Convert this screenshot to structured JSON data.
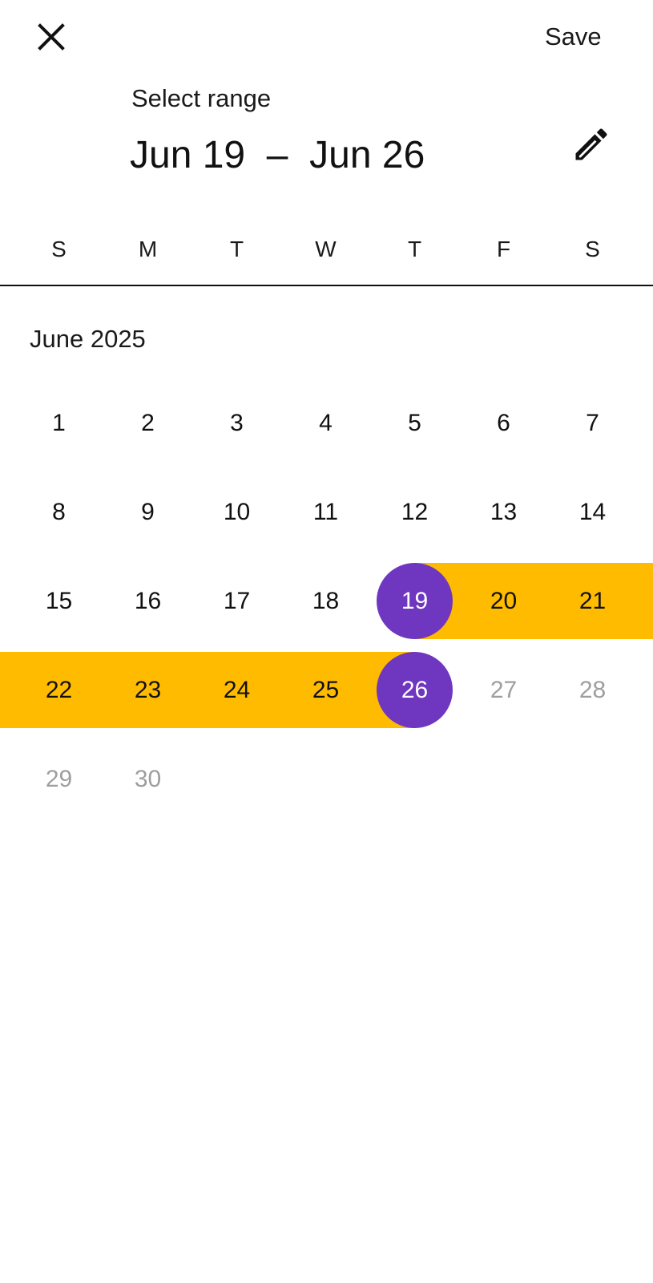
{
  "header": {
    "close_icon": "close-icon",
    "save_label": "Save",
    "range_label": "Select range",
    "range_value": "Jun 19  –  Jun 26",
    "edit_icon": "pencil-icon"
  },
  "weekdays": [
    "S",
    "M",
    "T",
    "W",
    "T",
    "F",
    "S"
  ],
  "month": {
    "title": "June 2025",
    "first_weekday_index": 0,
    "days": [
      {
        "n": "1",
        "state": "normal"
      },
      {
        "n": "2",
        "state": "normal"
      },
      {
        "n": "3",
        "state": "normal"
      },
      {
        "n": "4",
        "state": "normal"
      },
      {
        "n": "5",
        "state": "normal"
      },
      {
        "n": "6",
        "state": "normal"
      },
      {
        "n": "7",
        "state": "normal"
      },
      {
        "n": "8",
        "state": "normal"
      },
      {
        "n": "9",
        "state": "normal"
      },
      {
        "n": "10",
        "state": "normal"
      },
      {
        "n": "11",
        "state": "normal"
      },
      {
        "n": "12",
        "state": "normal"
      },
      {
        "n": "13",
        "state": "normal"
      },
      {
        "n": "14",
        "state": "normal"
      },
      {
        "n": "15",
        "state": "normal"
      },
      {
        "n": "16",
        "state": "normal"
      },
      {
        "n": "17",
        "state": "normal"
      },
      {
        "n": "18",
        "state": "normal"
      },
      {
        "n": "19",
        "state": "range-start"
      },
      {
        "n": "20",
        "state": "in-range"
      },
      {
        "n": "21",
        "state": "in-range"
      },
      {
        "n": "22",
        "state": "in-range"
      },
      {
        "n": "23",
        "state": "in-range"
      },
      {
        "n": "24",
        "state": "in-range"
      },
      {
        "n": "25",
        "state": "in-range"
      },
      {
        "n": "26",
        "state": "range-end"
      },
      {
        "n": "27",
        "state": "disabled"
      },
      {
        "n": "28",
        "state": "disabled"
      },
      {
        "n": "29",
        "state": "disabled"
      },
      {
        "n": "30",
        "state": "disabled"
      }
    ]
  },
  "colors": {
    "selected_circle": "#6f37c0",
    "range_band": "#ffbb00",
    "disabled_text": "#9e9e9e"
  }
}
